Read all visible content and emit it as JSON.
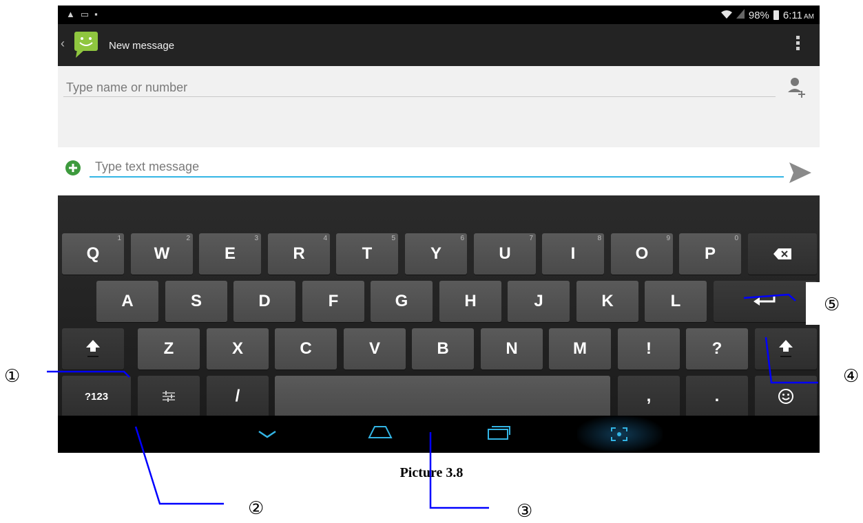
{
  "status_bar": {
    "left_icons": [
      "warning-icon",
      "image-icon",
      "lock-icon"
    ],
    "battery": "98%",
    "time": "6:11",
    "ampm": "AM"
  },
  "action_bar": {
    "title": "New message"
  },
  "recipient": {
    "placeholder": "Type name or number"
  },
  "compose": {
    "placeholder": "Type text message"
  },
  "keyboard": {
    "row1": [
      {
        "label": "Q",
        "hint": "1"
      },
      {
        "label": "W",
        "hint": "2"
      },
      {
        "label": "E",
        "hint": "3"
      },
      {
        "label": "R",
        "hint": "4"
      },
      {
        "label": "T",
        "hint": "5"
      },
      {
        "label": "Y",
        "hint": "6"
      },
      {
        "label": "U",
        "hint": "7"
      },
      {
        "label": "I",
        "hint": "8"
      },
      {
        "label": "O",
        "hint": "9"
      },
      {
        "label": "P",
        "hint": "0"
      }
    ],
    "row2": [
      "A",
      "S",
      "D",
      "F",
      "G",
      "H",
      "J",
      "K",
      "L"
    ],
    "row3": [
      "Z",
      "X",
      "C",
      "V",
      "B",
      "N",
      "M",
      "!",
      "?"
    ],
    "row4": {
      "symbols": "?123",
      "slash": "/",
      "comma": ",",
      "period": "."
    }
  },
  "annotations": {
    "c1": "①",
    "c2": "②",
    "c3": "③",
    "c4": "④",
    "c5": "⑤"
  },
  "caption": "Picture 3.8",
  "colors": {
    "accent": "#33b5e5",
    "callout_line": "#0000ff",
    "keyboard_bg": "#232323"
  }
}
